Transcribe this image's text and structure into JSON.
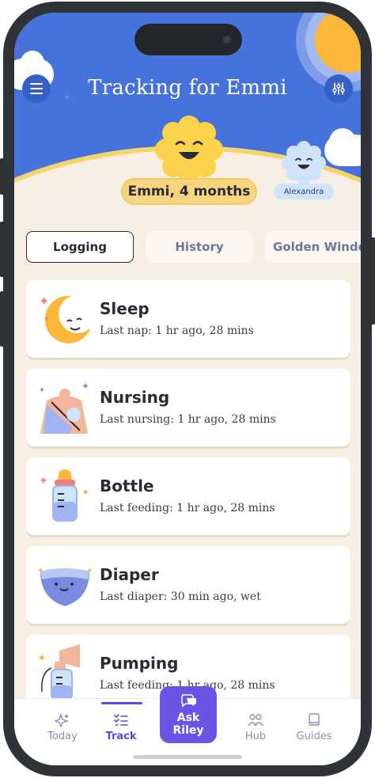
{
  "header": {
    "title": "Tracking for Emmi",
    "child_label": "Emmi, 4 months",
    "secondary_child_label": "Alexandra"
  },
  "tabs": [
    {
      "label": "Logging",
      "active": true
    },
    {
      "label": "History",
      "active": false
    },
    {
      "label": "Golden Window",
      "active": false
    }
  ],
  "cards": [
    {
      "title": "Sleep",
      "subtitle": "Last nap: 1 hr ago, 28 mins",
      "icon": "moon-icon"
    },
    {
      "title": "Nursing",
      "subtitle": "Last nursing: 1 hr ago, 28 mins",
      "icon": "nursing-icon"
    },
    {
      "title": "Bottle",
      "subtitle": "Last feeding: 1 hr ago, 28 mins",
      "icon": "bottle-icon"
    },
    {
      "title": "Diaper",
      "subtitle": "Last diaper: 30 min ago, wet",
      "icon": "diaper-icon"
    },
    {
      "title": "Pumping",
      "subtitle": "Last feeding: 1 hr ago, 28 mins",
      "icon": "pump-icon"
    }
  ],
  "bottom_nav": {
    "today": "Today",
    "track": "Track",
    "ask_line1": "Ask",
    "ask_line2": "Riley",
    "hub": "Hub",
    "guides": "Guides"
  },
  "colors": {
    "sky": "#4672dc",
    "accent": "#6d52e6",
    "pill": "#f7d57e",
    "background": "#f8efe4"
  }
}
